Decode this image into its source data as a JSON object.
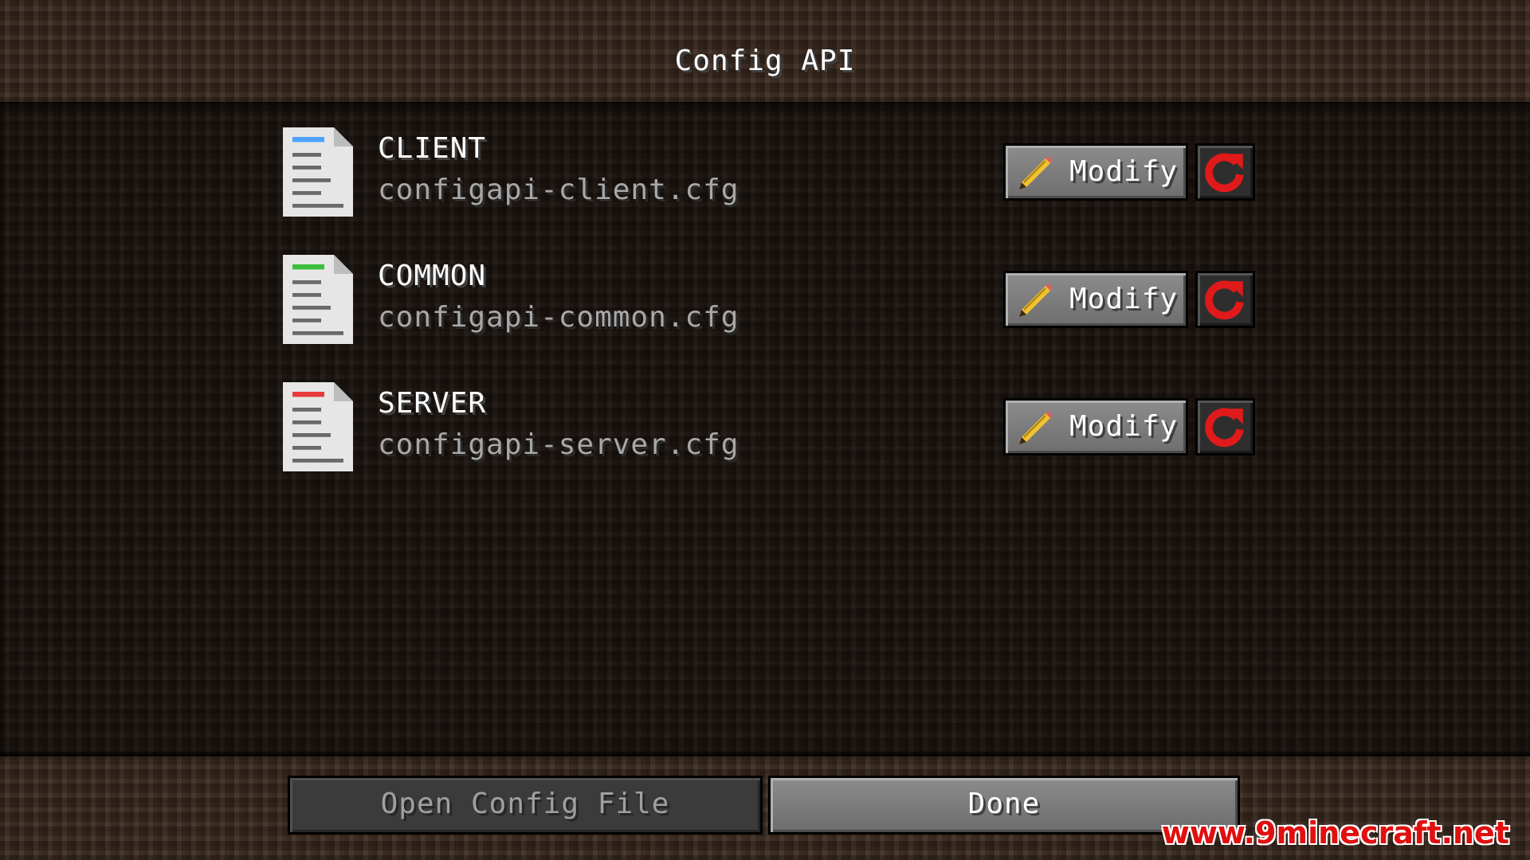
{
  "screen": {
    "title": "Config API"
  },
  "entries": [
    {
      "name": "CLIENT",
      "file": "configapi-client.cfg",
      "accent_color": "#4da3ff",
      "modify_label": "Modify"
    },
    {
      "name": "COMMON",
      "file": "configapi-common.cfg",
      "accent_color": "#3cbf3c",
      "modify_label": "Modify"
    },
    {
      "name": "SERVER",
      "file": "configapi-server.cfg",
      "accent_color": "#e83a3a",
      "modify_label": "Modify"
    }
  ],
  "footer": {
    "open_config_label": "Open Config File",
    "done_label": "Done"
  },
  "watermark": "www.9minecraft.net",
  "colors": {
    "reset_icon": "#e01a1a",
    "text_primary": "#ffffff",
    "text_secondary": "#a8a8a8"
  }
}
